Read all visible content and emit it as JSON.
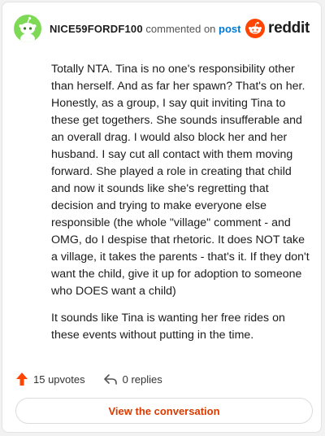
{
  "header": {
    "username": "NICE59FORDF100",
    "action_text": "commented on",
    "post_link": "post",
    "brand": "reddit"
  },
  "comment": {
    "paragraphs": [
      "Totally NTA. Tina is no one's responsibility other than herself. And as far her spawn? That's on her. Honestly, as a group, I say quit inviting Tina to these get togethers. She sounds insufferable and an overall drag. I would also block her and her husband. I say cut all contact with them moving forward. She played a role in creating that child and now it sounds like she's regretting that decision and trying to make everyone else responsible (the whole \"village\" comment - and OMG, do I despise that rhetoric. It does NOT take a village, it takes the parents - that's it. If they don't want the child, give it up for adoption to someone who DOES want a child)",
      "It sounds like Tina is wanting her free rides on these events without putting in the time."
    ]
  },
  "stats": {
    "upvotes": "15 upvotes",
    "replies": "0 replies"
  },
  "cta": {
    "label": "View the conversation"
  },
  "colors": {
    "brand": "#ff4500",
    "link": "#0079d3",
    "cta": "#d93a00",
    "avatar": "#7ed957"
  },
  "icons": {
    "avatar": "snoo-avatar-icon",
    "brand": "reddit-logo-icon",
    "upvote": "upvote-arrow-icon",
    "reply": "reply-arrow-icon"
  }
}
